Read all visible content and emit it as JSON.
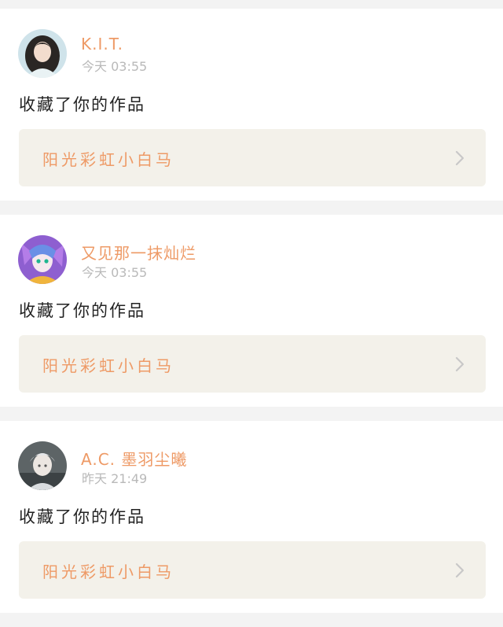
{
  "notifications": [
    {
      "user": "K.I.T.",
      "time": "今天 03:55",
      "action": "收藏了你的作品",
      "work": "阳光彩虹小白马",
      "avatar_icon": "avatar-girl-icon"
    },
    {
      "user": "又见那一抹灿烂",
      "time": "今天 03:55",
      "action": "收藏了你的作品",
      "work": "阳光彩虹小白马",
      "avatar_icon": "avatar-anime-icon"
    },
    {
      "user": "A.C. 墨羽尘曦",
      "time": "昨天 21:49",
      "action": "收藏了你的作品",
      "work": "阳光彩虹小白马",
      "avatar_icon": "avatar-silver-hair-icon"
    }
  ],
  "colors": {
    "accent": "#ee9a66",
    "muted": "#b9b9b9",
    "work_bg": "#f3f1ea",
    "page_bg": "#f3f3f3"
  }
}
